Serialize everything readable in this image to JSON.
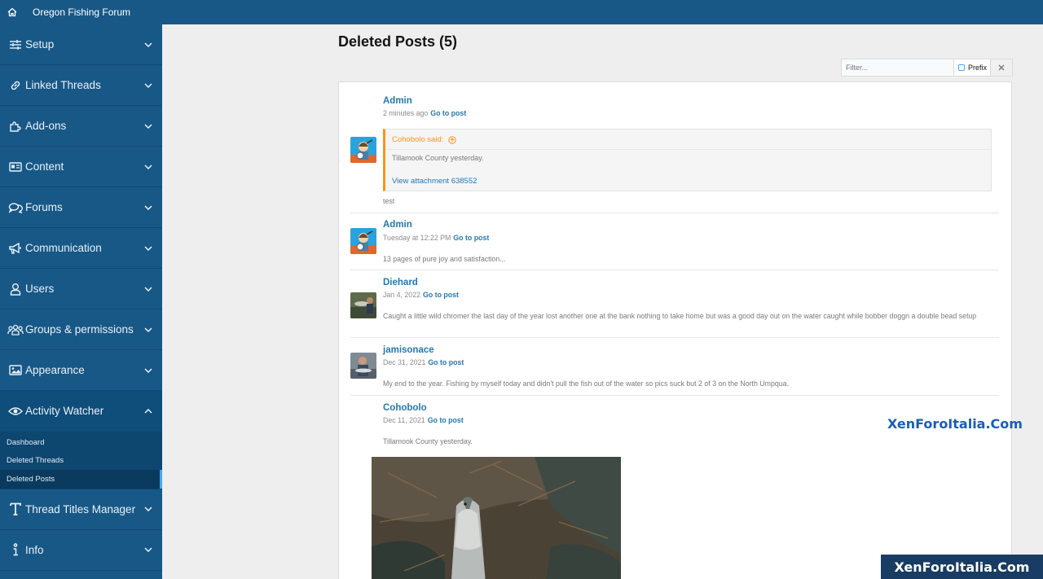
{
  "header": {
    "title": "Oregon Fishing Forum",
    "home_icon": "home-icon"
  },
  "sidebar": {
    "items": [
      {
        "label": "Setup",
        "icon": "sliders-icon"
      },
      {
        "label": "Linked Threads",
        "icon": "link-icon"
      },
      {
        "label": "Add-ons",
        "icon": "puzzle-icon"
      },
      {
        "label": "Content",
        "icon": "newspaper-icon"
      },
      {
        "label": "Forums",
        "icon": "comments-icon"
      },
      {
        "label": "Communication",
        "icon": "megaphone-icon"
      },
      {
        "label": "Users",
        "icon": "user-icon"
      },
      {
        "label": "Groups & permissions",
        "icon": "users-icon"
      },
      {
        "label": "Appearance",
        "icon": "image-icon"
      },
      {
        "label": "Activity Watcher",
        "icon": "eye-icon"
      },
      {
        "label": "Thread Titles Manager",
        "icon": "text-t-icon"
      },
      {
        "label": "Info",
        "icon": "info-icon"
      }
    ],
    "sub_items": [
      "Dashboard",
      "Deleted Threads",
      "Deleted Posts"
    ],
    "active_sub": "Deleted Posts"
  },
  "page": {
    "title": "Deleted Posts (5)"
  },
  "filter": {
    "placeholder": "Filter...",
    "prefix_label": "Prefix",
    "clear_symbol": "✕"
  },
  "posts": [
    {
      "user": "Admin",
      "time": "2 minutes ago",
      "go_label": "Go to post",
      "quote": {
        "author": "Cohobolo said:",
        "text": "Tillamook County yesterday.",
        "link": "View attachment 638552"
      },
      "text": "test"
    },
    {
      "user": "Admin",
      "time": "Tuesday at 12:22 PM",
      "go_label": "Go to post",
      "text": "13 pages of pure joy and satisfaction..."
    },
    {
      "user": "Diehard",
      "time": "Jan 4, 2022",
      "go_label": "Go to post",
      "text": "Caught a little wild chromer the last day of the year lost another one at the bank nothing to take home but was a good day out on the water caught while bobber doggn a double bead setup"
    },
    {
      "user": "jamisonace",
      "time": "Dec 31, 2021",
      "go_label": "Go to post",
      "text": "My end to the year. Fishing by myself today and didn't pull the fish out of the water so pics suck but 2 of 3 on the North Umpqua."
    },
    {
      "user": "Cohobolo",
      "time": "Dec 11, 2021",
      "go_label": "Go to post",
      "text": "Tillamook County yesterday."
    }
  ],
  "watermark": {
    "text": "XenForoItalia.Com"
  },
  "colors": {
    "brand": "#185886",
    "link": "#2577b1",
    "quote_accent": "#f7941e",
    "watermark": "#1a5fb4"
  }
}
